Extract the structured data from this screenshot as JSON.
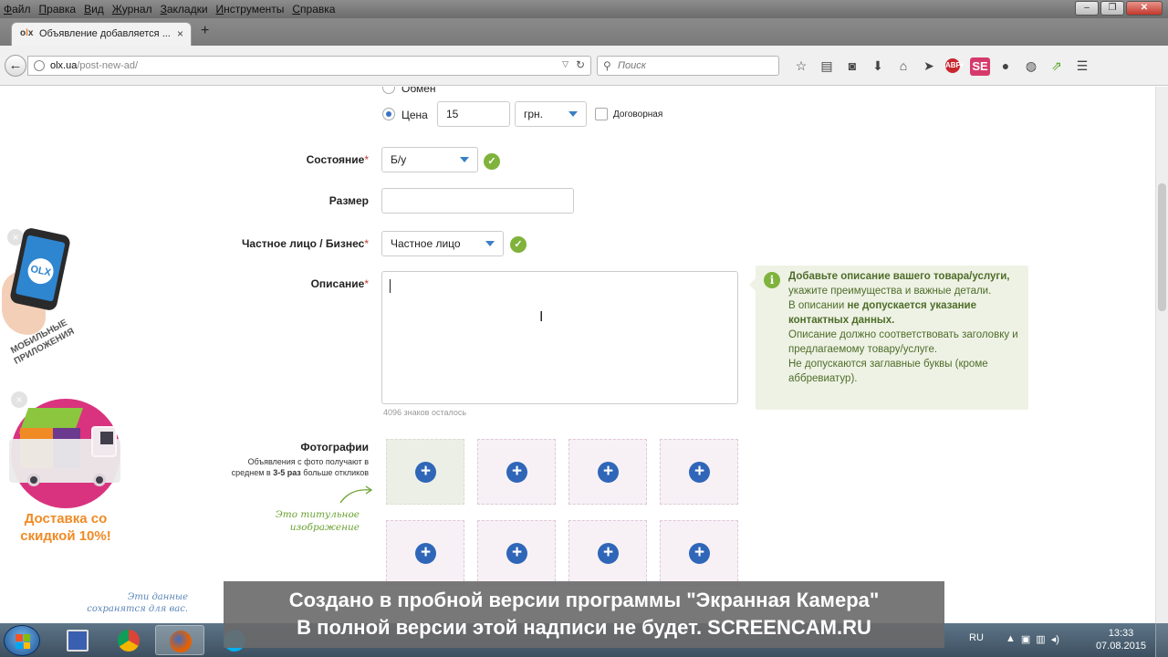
{
  "browser": {
    "menu": [
      "Файл",
      "Правка",
      "Вид",
      "Журнал",
      "Закладки",
      "Инструменты",
      "Справка"
    ],
    "tab": {
      "favicon": "olx",
      "title": "Объявление добавляется ...",
      "close": "×"
    },
    "new_tab": "+",
    "url": {
      "host": "olx.ua",
      "path": "/post-new-ad/"
    },
    "search_placeholder": "Поиск",
    "toolbar_icons": [
      "star-icon",
      "reading-list-icon",
      "pocket-icon",
      "download-icon",
      "home-icon",
      "send-icon",
      "adblock-icon",
      "se-icon",
      "chat-icon",
      "globe-icon",
      "share-icon",
      "menu-icon"
    ],
    "adblock_label": "ABP",
    "se_label": "SE"
  },
  "form": {
    "exchange_label": "Обмен",
    "price": {
      "label": "Цена",
      "value": "15",
      "currency": "грн.",
      "negotiable_label": "Договорная"
    },
    "condition": {
      "label": "Состояние",
      "required": "*",
      "value": "Б/у"
    },
    "size": {
      "label": "Размер",
      "value": ""
    },
    "seller_type": {
      "label": "Частное лицо / Бизнес",
      "required": "*",
      "value": "Частное лицо"
    },
    "description": {
      "label": "Описание",
      "required": "*",
      "value": "",
      "counter": "4096 знаков осталось"
    },
    "hint": {
      "l1_bold": "Добавьте описание вашего товара/услуги,",
      "l1": " укажите преимущества и важные детали.",
      "l2": "В описании ",
      "l2_bold": "не допускается указание контактных данных.",
      "l3": "Описание должно соответствовать заголовку и предлагаемому товару/услуге.",
      "l4": "Не допускаются заглавные буквы (кроме аббревиатур)."
    },
    "photos": {
      "label": "Фотографии",
      "sub_a": "Объявления с фото получают в среднем в ",
      "sub_bold": "3-5 раз",
      "sub_b": " больше откликов",
      "title_note": "Это титульное изображение",
      "slots": 8,
      "add": "+"
    }
  },
  "ads": {
    "mobile_apps": "МОБИЛЬНЫЕ ПРИЛОЖЕНИЯ",
    "phone_logo": "OLX",
    "delivery": "Доставка со скидкой 10%!",
    "close": "×",
    "saved_note": "Эти данные сохранятся для вас."
  },
  "watermark": {
    "line1": "Создано в пробной версии программы \"Экранная Камера\"",
    "line2": "В полной версии этой надписи не будет. SCREENCAM.RU"
  },
  "taskbar": {
    "lang": "RU",
    "time": "13:33",
    "date": "07.08.2015",
    "apps": [
      "save-icon",
      "chrome-icon",
      "firefox-icon",
      "skype-icon",
      "app-icon",
      "app-icon",
      "app-icon"
    ]
  },
  "colors": {
    "accent": "#2f66b8",
    "ok": "#7fb33c",
    "hint_bg": "#eef2e4",
    "hint_text": "#4e6d2a",
    "ad_pink": "#d9337f",
    "ad_orange": "#f08a24"
  }
}
